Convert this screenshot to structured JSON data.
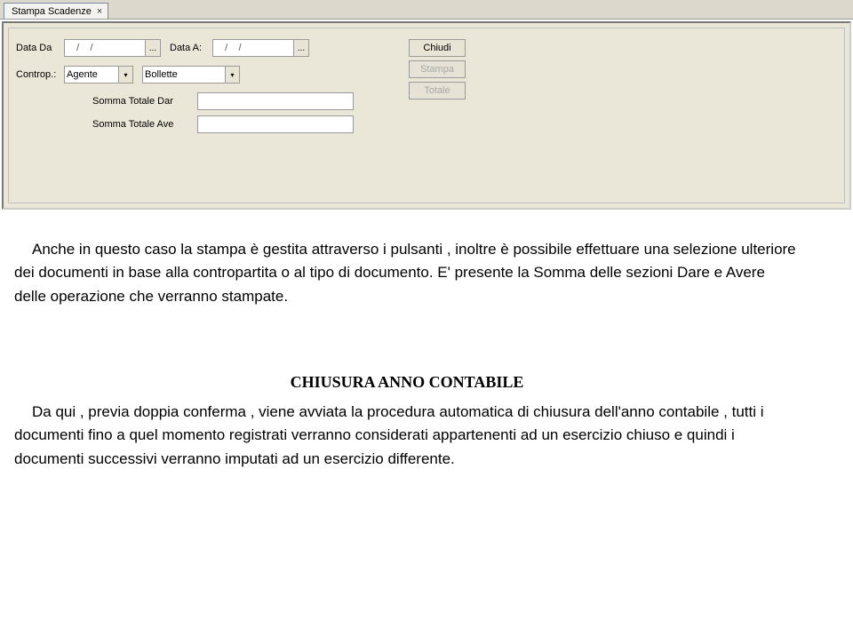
{
  "tab": {
    "title": "Stampa Scadenze",
    "close": "×"
  },
  "form": {
    "dataDa": {
      "label": "Data Da",
      "value": "   /    /"
    },
    "dataA": {
      "label": "Data A:",
      "value": "   /    /"
    },
    "ellipsis": "...",
    "controp": {
      "label": "Controp.:"
    },
    "comboAgente": "Agente",
    "comboBollette": "Bollette",
    "sommaDare": {
      "label": "Somma Totale Dar",
      "value": ""
    },
    "sommaAvere": {
      "label": "Somma Totale Ave",
      "value": ""
    }
  },
  "buttons": {
    "chiudi": "Chiudi",
    "stampa": "Stampa",
    "totale": "Totale"
  },
  "doc": {
    "para1": "Anche in questo caso la stampa è gestita attraverso i pulsanti , inoltre è possibile effettuare una selezione ulteriore dei documenti in base alla contropartita o al tipo di documento. E' presente la Somma delle sezioni Dare e Avere delle operazione che verranno stampate.",
    "heading": "CHIUSURA ANNO CONTABILE",
    "para2": "Da qui , previa doppia conferma , viene avviata la procedura automatica di chiusura dell'anno contabile , tutti i documenti fino a quel momento registrati verranno considerati appartenenti ad un esercizio chiuso e quindi i documenti successivi verranno imputati ad un esercizio differente."
  }
}
